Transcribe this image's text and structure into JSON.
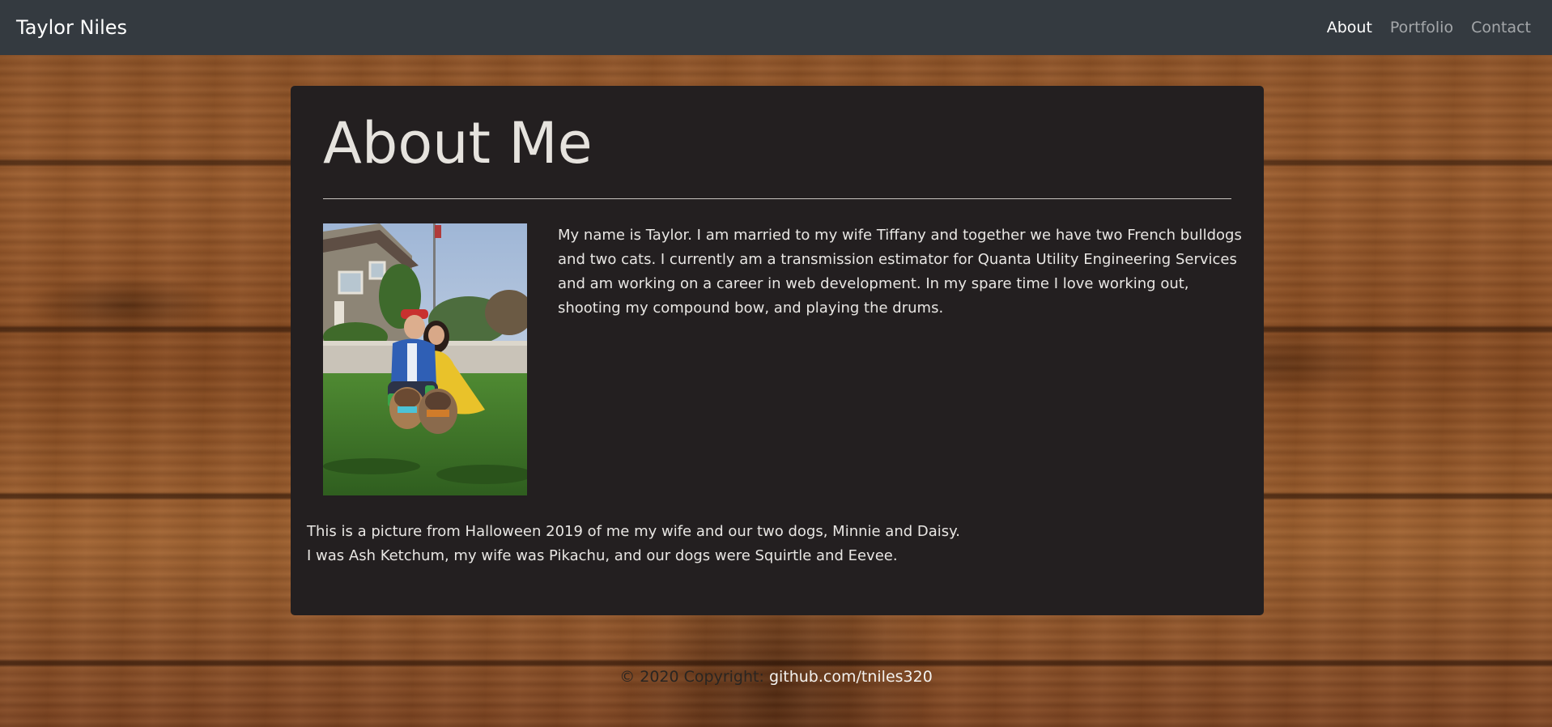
{
  "navbar": {
    "brand": "Taylor Niles",
    "links": [
      {
        "label": "About",
        "active": true
      },
      {
        "label": "Portfolio",
        "active": false
      },
      {
        "label": "Contact",
        "active": false
      }
    ]
  },
  "main": {
    "title": "About Me",
    "photo_icon": "family-halloween-photo",
    "bio": "My name is Taylor. I am married to my wife Tiffany and together we have two French bulldogs and two cats. I currently am a transmission estimator for Quanta Utility Engineering Services and am working on a career in web development. In my spare time I love working out, shooting my compound bow, and playing the drums.",
    "caption_line1": "This is a picture from Halloween 2019 of me my wife and our two dogs, Minnie and Daisy.",
    "caption_line2": "I was Ash Ketchum, my wife was Pikachu, and our dogs were Squirtle and Eevee."
  },
  "footer": {
    "copyright": "© 2020 Copyright:",
    "link_label": "github.com/tniles320"
  },
  "colors": {
    "navbar_bg": "#343a40",
    "card_bg": "#231f20",
    "text_light": "#e8e6e3"
  }
}
